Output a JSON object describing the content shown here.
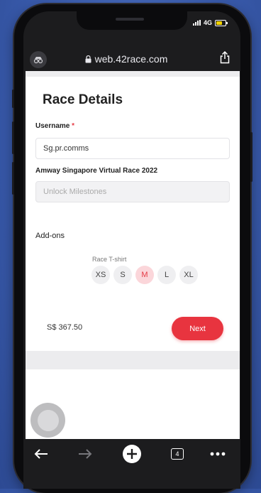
{
  "status_bar": {
    "network": "4G"
  },
  "browser": {
    "url": "web.42race.com",
    "tabs_count": "4"
  },
  "page": {
    "title": "Race Details",
    "username_label": "Username",
    "required_mark": "*",
    "username_value": "Sg.pr.comms",
    "race_label": "Amway Singapore Virtual Race 2022",
    "milestone_placeholder": "Unlock Milestones",
    "addons_label": "Add-ons",
    "tshirt_label": "Race T-shirt",
    "sizes": [
      "XS",
      "S",
      "M",
      "L",
      "XL"
    ],
    "selected_size": "M",
    "price": "S$ 367.50",
    "next_label": "Next"
  },
  "colors": {
    "accent": "#e8343f",
    "background": "#3a5cae"
  }
}
